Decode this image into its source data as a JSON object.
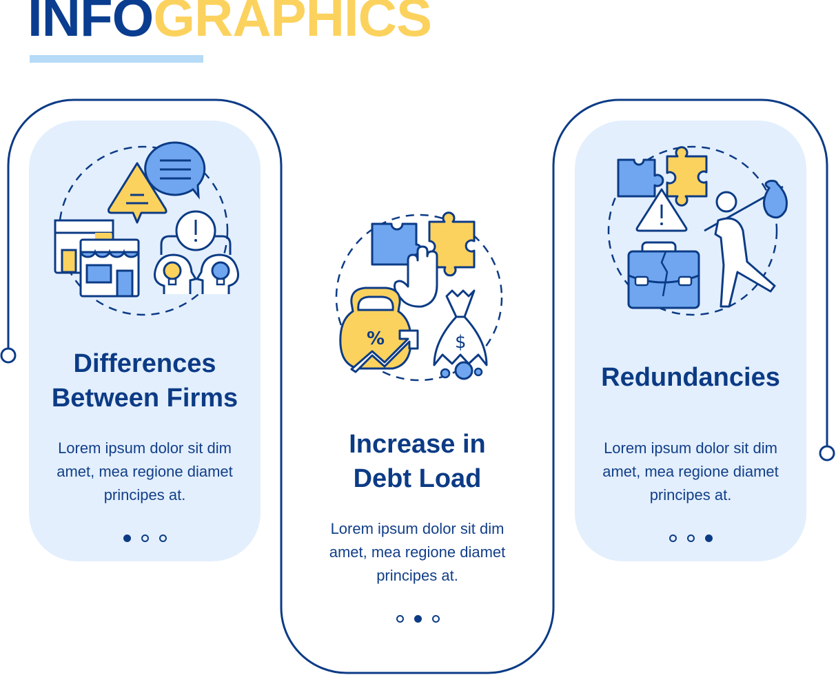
{
  "header": {
    "title_part1": "INFO",
    "title_part2": "GRAPHICS"
  },
  "colors": {
    "navy": "#0c3b85",
    "yellow": "#fcd25e",
    "blue": "#6fa6ef",
    "panel": "#e3effd",
    "underline": "#b6dbf7"
  },
  "cards": [
    {
      "icon": "firm-differences-icon",
      "title_line1": "Differences",
      "title_line2": "Between Firms",
      "body_line1": "Lorem ipsum dolor sit dim",
      "body_line2": "amet, mea regione diamet",
      "body_line3": "principes at.",
      "step": 1,
      "total_steps": 3
    },
    {
      "icon": "debt-load-icon",
      "title_line1": "Increase in",
      "title_line2": "Debt Load",
      "body_line1": "Lorem ipsum dolor sit dim",
      "body_line2": "amet, mea regione diamet",
      "body_line3": "principes at.",
      "step": 2,
      "total_steps": 3
    },
    {
      "icon": "redundancies-icon",
      "title_line1": "Redundancies",
      "body_line1": "Lorem ipsum dolor sit dim",
      "body_line2": "amet, mea regione diamet",
      "body_line3": "principes at.",
      "step": 3,
      "total_steps": 3
    }
  ]
}
